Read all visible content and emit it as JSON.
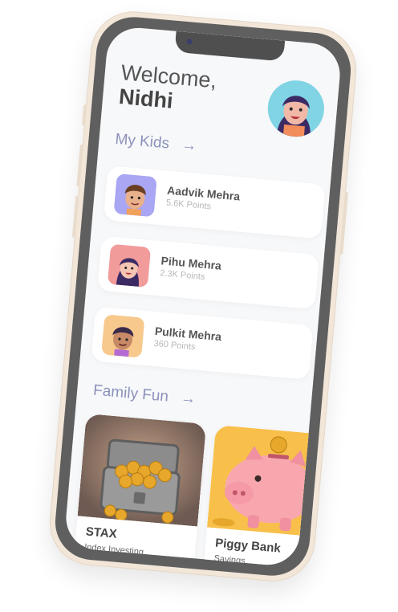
{
  "greeting": {
    "line1": "Welcome,",
    "name": "Nidhi"
  },
  "sections": {
    "kids_title": "My Kids",
    "fun_title": "Family Fun",
    "arrow": "→"
  },
  "kids": [
    {
      "name": "Aadvik Mehra",
      "points": "5.6K Points",
      "avatar_bg": "#a9a6f3"
    },
    {
      "name": "Pihu Mehra",
      "points": "2.3K Points",
      "avatar_bg": "#f29b9b"
    },
    {
      "name": "Pulkit Mehra",
      "points": "360 Points",
      "avatar_bg": "#f7c98d"
    }
  ],
  "fun": [
    {
      "title": "STAX",
      "subtitle": "Index Investing"
    },
    {
      "title": "Piggy Bank",
      "subtitle": "Savings"
    }
  ],
  "colors": {
    "accent": "#8d92ba",
    "screen_bg": "#f7f8fa",
    "phone_frame": "#f2e6d8"
  }
}
